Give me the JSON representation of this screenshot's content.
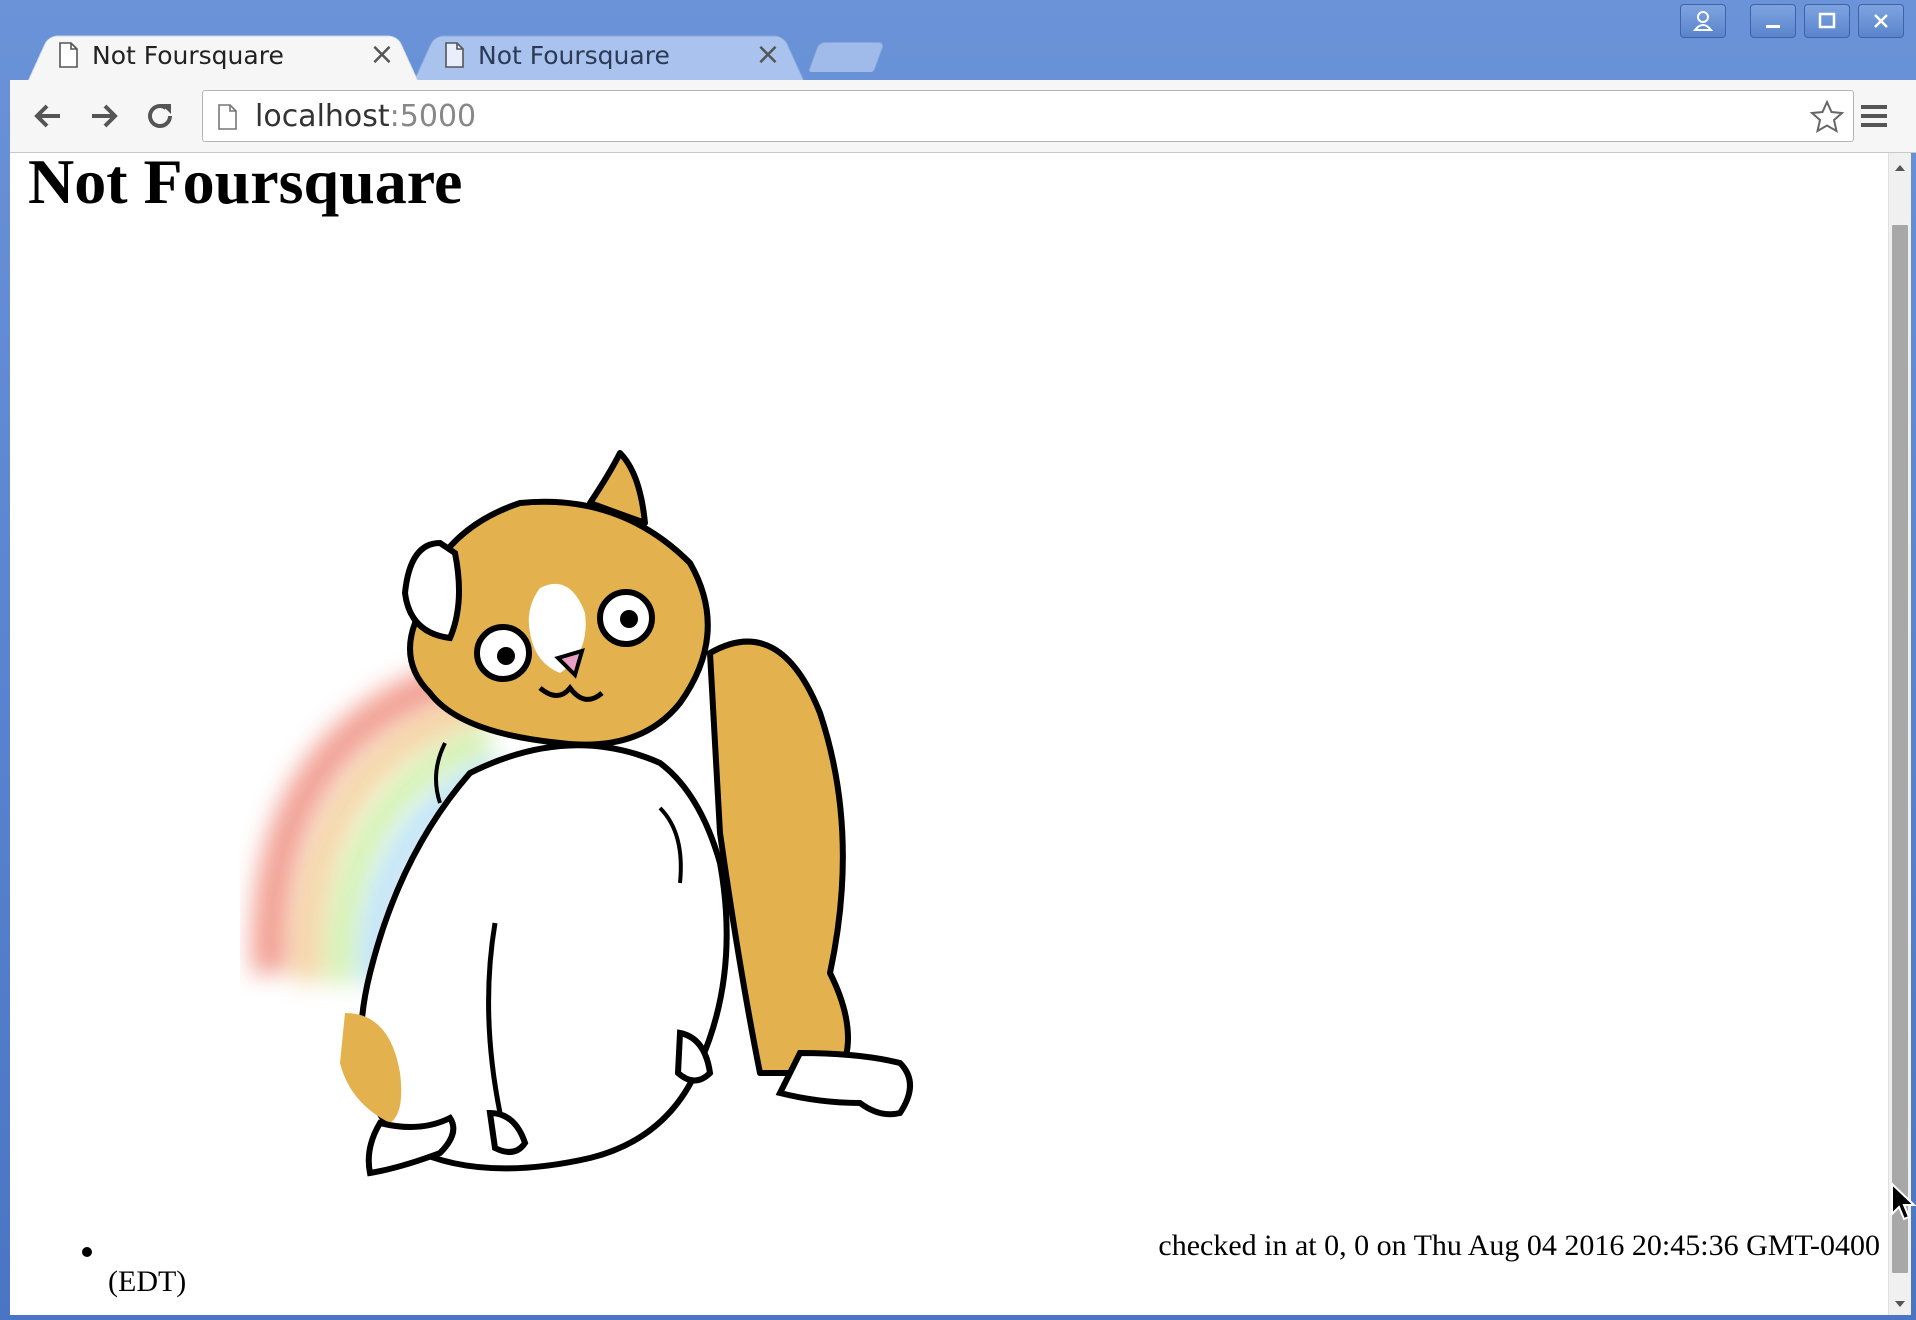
{
  "browser": {
    "tabs": [
      {
        "title": "Not Foursquare",
        "active": true
      },
      {
        "title": "Not Foursquare",
        "active": false
      }
    ],
    "address": {
      "host": "localhost",
      "port": ":5000"
    },
    "icons": {
      "back": "back-arrow-icon",
      "forward": "forward-arrow-icon",
      "reload": "reload-icon",
      "bookmark": "star-icon",
      "menu": "hamburger-menu-icon",
      "profile": "profile-icon"
    },
    "colors": {
      "frame": "#4a75c4",
      "toolbar": "#f6f6f6",
      "hamster_fur": "#e3b24f"
    }
  },
  "page": {
    "title": "Not Foursquare",
    "image": "hamster-rainbow-illustration",
    "checkins": [
      {
        "text": "checked in at 0, 0 on Thu Aug 04 2016 20:45:36 GMT-0400",
        "tz": "(EDT)"
      }
    ]
  }
}
